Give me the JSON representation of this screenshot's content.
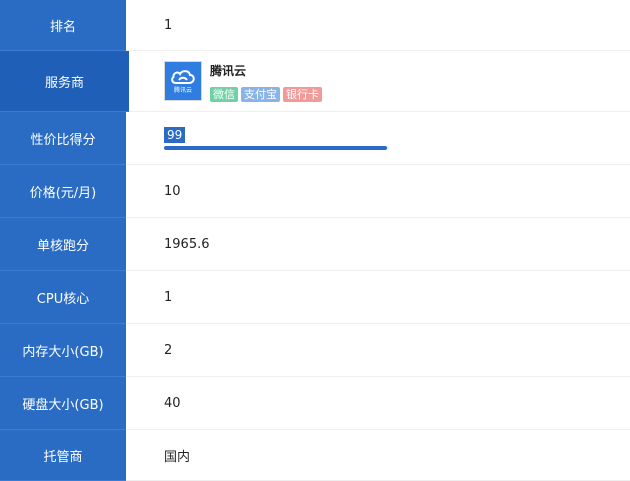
{
  "rows": [
    {
      "label": "排名",
      "value": "1"
    },
    {
      "label": "服务商",
      "provider": {
        "name": "腾讯云",
        "logo_text": "腾讯云",
        "tags": [
          "微信",
          "支付宝",
          "银行卡"
        ]
      }
    },
    {
      "label": "性价比得分",
      "score": 99,
      "score_text": "99"
    },
    {
      "label": "价格(元/月)",
      "value": "10"
    },
    {
      "label": "单核跑分",
      "value": "1965.6"
    },
    {
      "label": "CPU核心",
      "value": "1"
    },
    {
      "label": "内存大小(GB)",
      "value": "2"
    },
    {
      "label": "硬盘大小(GB)",
      "value": "40"
    },
    {
      "label": "托管商",
      "value": "国内"
    }
  ],
  "colors": {
    "label_bg": "#2a6cc4",
    "label_active_bg": "#1f5fb8",
    "tag_wechat": "#6fd1a5",
    "tag_alipay": "#8ab4e8",
    "tag_bank": "#f29a9a"
  },
  "icons": {
    "logo": "tencent-cloud-logo-icon"
  }
}
